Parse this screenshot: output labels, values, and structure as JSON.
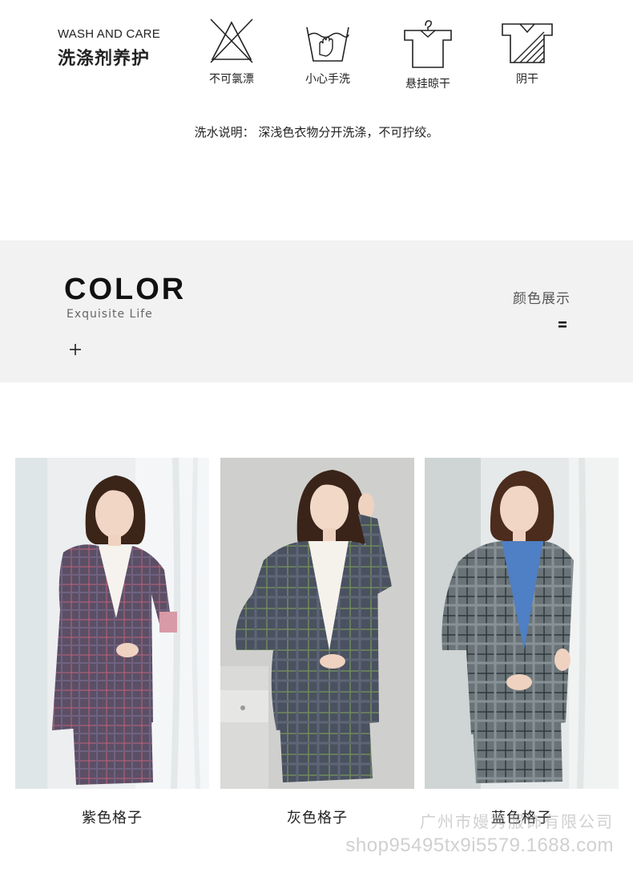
{
  "care": {
    "title_en": "WASH AND CARE",
    "title_cn": "洗涤剂养护",
    "items": [
      {
        "icon": "no-bleach-icon",
        "label": "不可氯漂"
      },
      {
        "icon": "hand-wash-icon",
        "label": "小心手洗"
      },
      {
        "icon": "hang-dry-icon",
        "label": "悬挂晾干"
      },
      {
        "icon": "shade-dry-icon",
        "label": "阴干"
      }
    ],
    "note": "洗水说明：  深浅色衣物分开洗涤，不可拧绞。"
  },
  "color_banner": {
    "title": "COLOR",
    "subtitle": "Exquisite Life",
    "label_cn": "颜色展示"
  },
  "products": [
    {
      "caption": "紫色格子"
    },
    {
      "caption": "灰色格子"
    },
    {
      "caption": "蓝色格子"
    }
  ],
  "watermark": {
    "company": "广州市嫚秀服饰有限公司",
    "shop": "shop95495tx9i5579.1688.com"
  },
  "colors": {
    "banner_bg": "#f2f2f2",
    "text": "#222222"
  }
}
